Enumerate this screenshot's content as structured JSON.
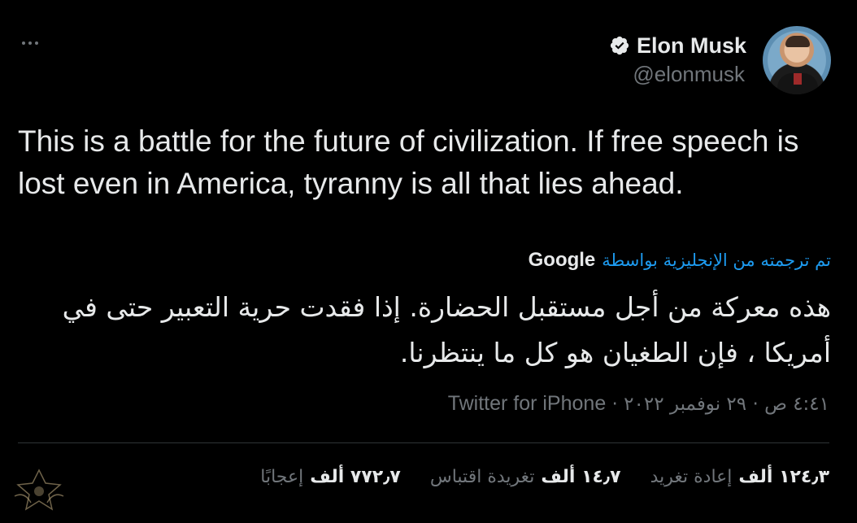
{
  "author": {
    "name": "Elon Musk",
    "handle": "@elonmusk"
  },
  "tweet_text": "This is a battle for the future of civilization. If free speech is lost even in America, tyranny is all that lies ahead.",
  "translation": {
    "translated_by_label": "تم ترجمته من الإنجليزية بواسطة",
    "provider": "Google",
    "text": "هذه معركة من أجل مستقبل الحضارة. إذا فقدت حرية التعبير حتى في أمريكا ، فإن الطغيان هو كل ما ينتظرنا."
  },
  "meta": {
    "time": "٤:٤١ ص",
    "date": "٢٩ نوفمبر ٢٠٢٢",
    "separator": "·",
    "source": "Twitter for iPhone"
  },
  "stats": [
    {
      "num": "١٢٤٫٣ ألف",
      "label": "إعادة تغريد"
    },
    {
      "num": "١٤٫٧ ألف",
      "label": "تغريدة اقتباس"
    },
    {
      "num": "٧٧٢٫٧ ألف",
      "label": "إعجابًا"
    }
  ],
  "colors": {
    "background": "#000000",
    "text": "#e7e9ea",
    "muted": "#71767b",
    "link": "#1d9bf0"
  },
  "icons": [
    "more-icon",
    "verified-badge-icon",
    "avatar",
    "watermark-logo"
  ]
}
